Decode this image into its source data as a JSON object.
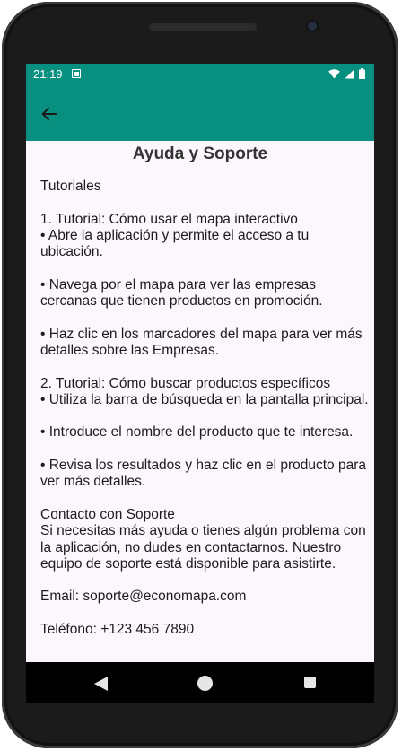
{
  "status_bar": {
    "time": "21:19",
    "icons": [
      "notification-icon",
      "wifi-icon",
      "cellular-signal-icon",
      "battery-icon"
    ]
  },
  "app_bar": {
    "back_icon": "arrow-back-icon",
    "color": "#07907f"
  },
  "page": {
    "title": "Ayuda y Soporte",
    "body": "Tutoriales\n\n1. Tutorial: Cómo usar el mapa interactivo\n• Abre la aplicación y permite el acceso a tu ubicación.\n\n• Navega por el mapa para ver las empresas cercanas que tienen productos en promoción.\n\n• Haz clic en los marcadores del mapa para ver más detalles sobre las Empresas.\n\n2. Tutorial: Cómo buscar productos específicos\n• Utiliza la barra de búsqueda en la pantalla principal.\n\n• Introduce el nombre del producto que te interesa.\n\n• Revisa los resultados y haz clic en el producto para ver más detalles.\n\nContacto con Soporte\nSi necesitas más ayuda o tienes algún problema con la aplicación, no dudes en contactarnos. Nuestro equipo de soporte está disponible para asistirte.\n\nEmail: soporte@economapa.com\n\nTeléfono: +123 456 7890"
  },
  "nav_bar": {
    "icons": [
      "nav-back-icon",
      "nav-home-icon",
      "nav-recents-icon"
    ]
  },
  "colors": {
    "accent": "#07907f",
    "background": "#fcf6fd",
    "text": "#1c1c1c"
  }
}
